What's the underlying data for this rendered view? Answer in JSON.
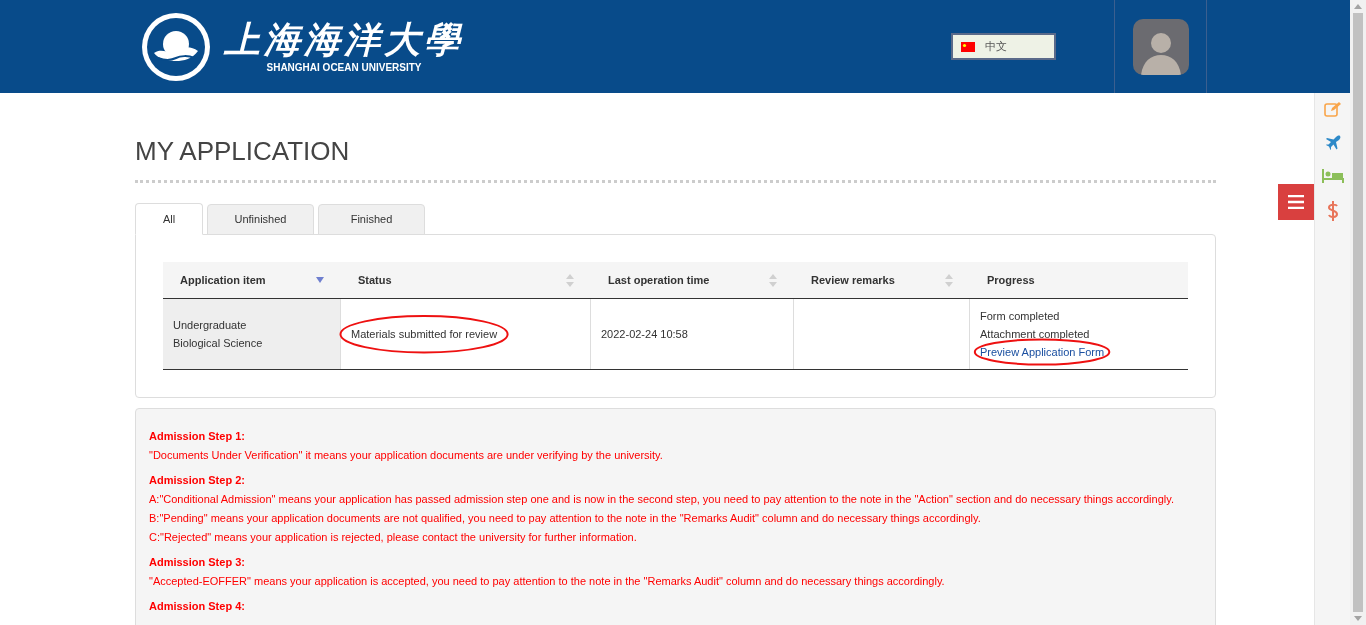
{
  "header": {
    "logo": {
      "chinese_name": "上海海洋大學",
      "english_name": "SHANGHAI OCEAN UNIVERSITY"
    },
    "language": {
      "label": "中文"
    }
  },
  "page_title": "MY APPLICATION",
  "tabs": [
    {
      "label": "All",
      "selected": true
    },
    {
      "label": "Unfinished",
      "selected": false
    },
    {
      "label": "Finished",
      "selected": false
    }
  ],
  "table": {
    "columns": [
      {
        "label": "Application item",
        "sorted": true
      },
      {
        "label": "Status",
        "sorted": false
      },
      {
        "label": "Last operation time",
        "sorted": false
      },
      {
        "label": "Review remarks",
        "sorted": false
      },
      {
        "label": "Progress"
      }
    ],
    "rows": [
      {
        "application_item": [
          "Undergraduate",
          "Biological Science"
        ],
        "status": {
          "text": "Materials submitted for review",
          "circled": true
        },
        "last_operation_time": "2022-02-24 10:58",
        "progress": {
          "lines": [
            "Form completed",
            "Attachment completed"
          ],
          "link": {
            "text": "Preview Application Form",
            "circled": true
          }
        }
      }
    ]
  },
  "notices": [
    {
      "heading": "Admission Step 1:",
      "lines": [
        "\"Documents Under Verification\" it means your application documents are under verifying by the university."
      ]
    },
    {
      "heading": "Admission Step 2:",
      "lines": [
        "A:\"Conditional Admission\" means your application has passed admission step one and is now in the second step, you need to pay attention to the note in the \"Action\" section and do necessary things accordingly.",
        "B:\"Pending\" means your application documents are not qualified, you need to pay attention to the note in the \"Remarks Audit\" column and do necessary things accordingly.",
        "C:\"Rejected\" means your application is rejected, please contact the university for further information."
      ]
    },
    {
      "heading": "Admission Step 3:",
      "lines": [
        "\"Accepted-EOFFER\" means your application is accepted, you need to pay attention to the note in the \"Remarks Audit\" column and do necessary things accordingly."
      ]
    },
    {
      "heading": "Admission Step 4:"
    }
  ]
}
